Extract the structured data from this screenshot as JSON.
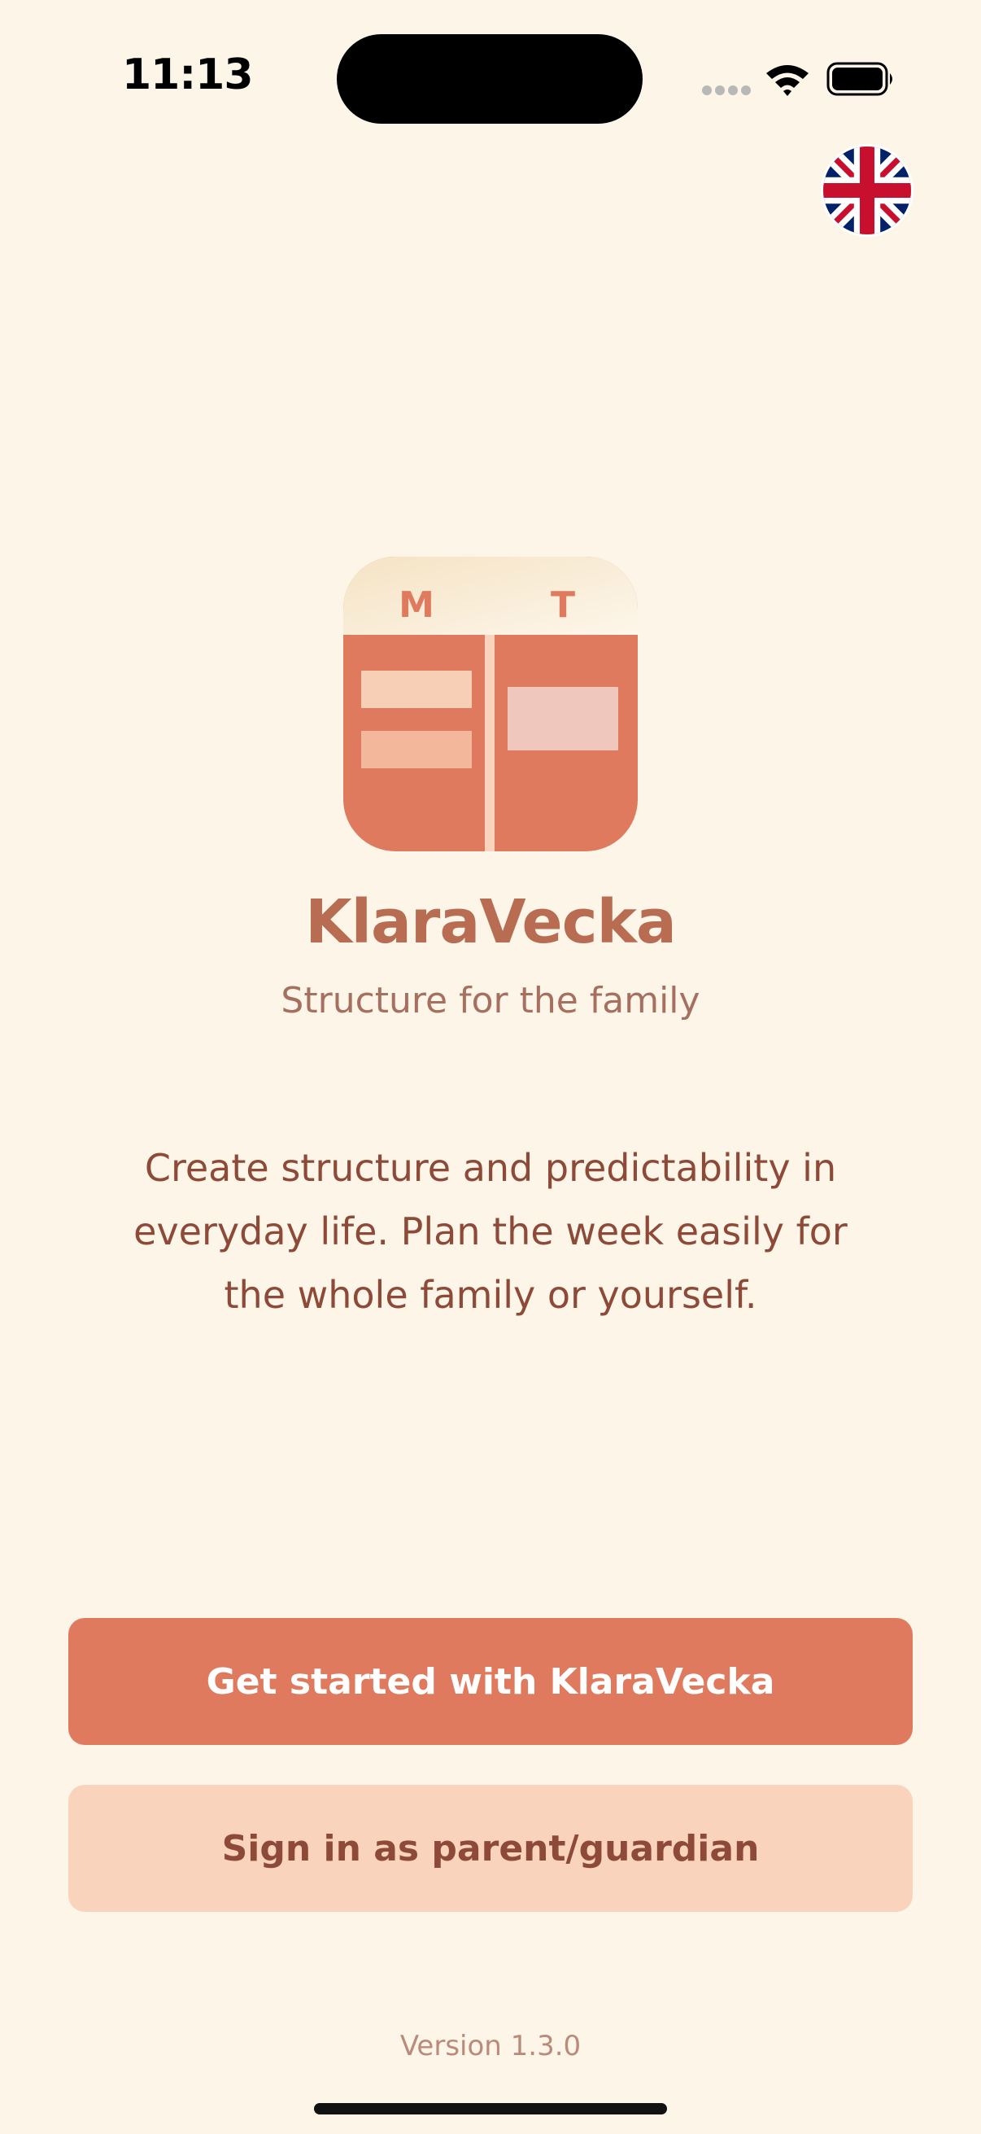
{
  "status_bar": {
    "time": "11:13",
    "icons": [
      "cellular-signal-icon",
      "wifi-icon",
      "battery-icon"
    ]
  },
  "language": {
    "icon": "uk-flag-icon"
  },
  "logo": {
    "day_labels": [
      "M",
      "T"
    ],
    "colors": {
      "header": "#fbf0dc",
      "body": "#e07a5f",
      "label": "#e07a5f",
      "block_light": "#f7cfb6",
      "block_mid": "#f3b79c",
      "block_alt": "#efc7bd"
    }
  },
  "app": {
    "name": "KlaraVecka",
    "tagline": "Structure for the family",
    "description": "Create structure and predictability in everyday life. Plan the week easily for the whole family or yourself."
  },
  "buttons": {
    "get_started": "Get started with KlaraVecka",
    "sign_in": "Sign in as parent/guardian"
  },
  "footer": {
    "version": "Version 1.3.0"
  },
  "colors": {
    "background": "#fdf5e8",
    "primary": "#e07a5f",
    "secondary": "#f9d3bc",
    "title": "#b86c52",
    "text": "#8e4a38"
  }
}
